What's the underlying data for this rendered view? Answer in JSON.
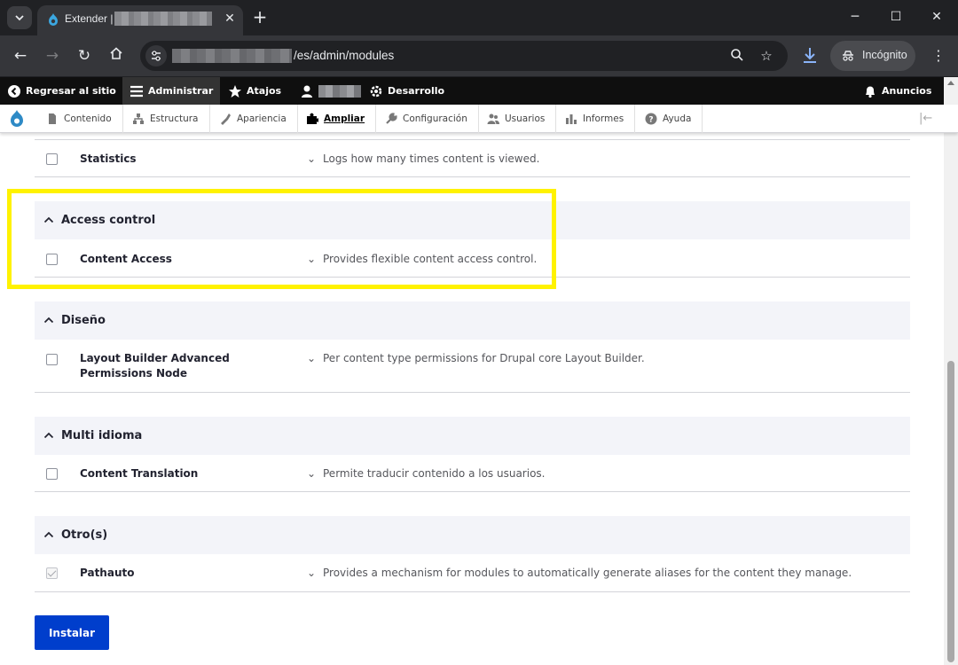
{
  "browser": {
    "tab_title": "Extender |",
    "new_tab": "+",
    "url_path": "/es/admin/modules",
    "incognito_label": "Incógnito"
  },
  "drupal_toolbar": {
    "back_to_site": "Regresar al sitio",
    "manage": "Administrar",
    "shortcuts": "Atajos",
    "devel": "Desarrollo",
    "announcements": "Anuncios"
  },
  "tray": {
    "items": [
      {
        "label": "Contenido",
        "icon": "document-icon"
      },
      {
        "label": "Estructura",
        "icon": "structure-icon"
      },
      {
        "label": "Apariencia",
        "icon": "brush-icon"
      },
      {
        "label": "Ampliar",
        "icon": "puzzle-icon"
      },
      {
        "label": "Configuración",
        "icon": "wrench-icon"
      },
      {
        "label": "Usuarios",
        "icon": "users-icon"
      },
      {
        "label": "Informes",
        "icon": "chart-icon"
      },
      {
        "label": "Ayuda",
        "icon": "help-icon"
      }
    ],
    "active": "Ampliar"
  },
  "modules": {
    "statistics": {
      "name": "Statistics",
      "desc": "Logs how many times content is viewed."
    },
    "access_control": {
      "title": "Access control",
      "items": [
        {
          "name": "Content Access",
          "desc": "Provides flexible content access control."
        }
      ]
    },
    "diseno": {
      "title": "Diseño",
      "items": [
        {
          "name": "Layout Builder Advanced Permissions Node",
          "desc": "Per content type permissions for Drupal core Layout Builder."
        }
      ]
    },
    "multi_idioma": {
      "title": "Multi idioma",
      "items": [
        {
          "name": "Content Translation",
          "desc": "Permite traducir contenido a los usuarios."
        }
      ]
    },
    "otros": {
      "title": "Otro(s)",
      "items": [
        {
          "name": "Pathauto",
          "desc": "Provides a mechanism for modules to automatically generate aliases for the content they manage.",
          "checked": true
        }
      ]
    }
  },
  "install_label": "Instalar",
  "colors": {
    "highlight": "#fff200",
    "primary_button": "#003ecc",
    "group_header_bg": "#f3f4f9"
  }
}
